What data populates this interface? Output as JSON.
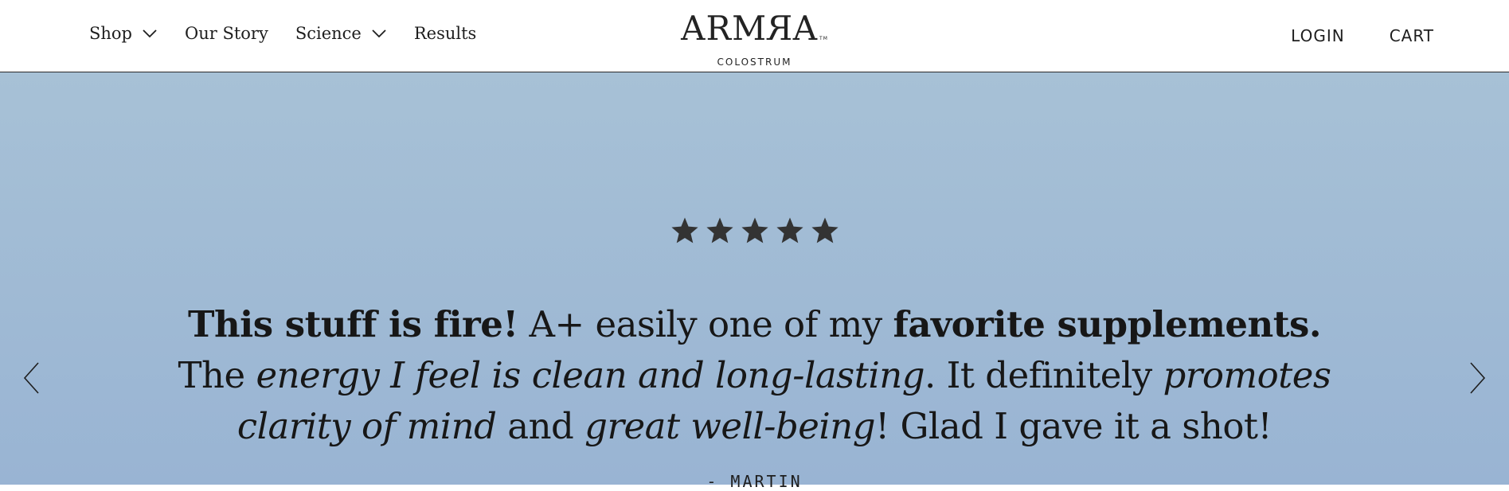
{
  "header": {
    "nav_left": {
      "shop": "Shop",
      "our_story": "Our Story",
      "science": "Science",
      "results": "Results"
    },
    "logo": {
      "word_part1": "ARM",
      "word_part2": "RA",
      "sub": "COLOSTRUM",
      "tm": "TM"
    },
    "nav_right": {
      "login": "LOGIN",
      "cart": "CART"
    }
  },
  "testimonial": {
    "rating": 5,
    "segments": [
      {
        "text": "This stuff is fire!",
        "style": "bold"
      },
      {
        "text": " A+ easily one of my ",
        "style": "normal"
      },
      {
        "text": "favorite supplements.",
        "style": "bold"
      },
      {
        "text": " The ",
        "style": "normal"
      },
      {
        "text": "energy I feel is clean and long-lasting",
        "style": "italic"
      },
      {
        "text": ". It definitely ",
        "style": "normal"
      },
      {
        "text": "promotes clarity of mind",
        "style": "italic"
      },
      {
        "text": " and ",
        "style": "normal"
      },
      {
        "text": "great well-being",
        "style": "italic"
      },
      {
        "text": "! Glad I gave it a shot!",
        "style": "normal"
      }
    ],
    "author": "- MARTIN"
  },
  "icons": {
    "shop_dropdown": "chevron-down-icon",
    "science_dropdown": "chevron-down-icon",
    "star": "star-icon",
    "prev": "chevron-left-icon",
    "next": "chevron-right-icon"
  },
  "colors": {
    "hero_top": "#a7c1d6",
    "hero_bottom": "#99b4d3",
    "text": "#171717",
    "star": "#333333"
  }
}
